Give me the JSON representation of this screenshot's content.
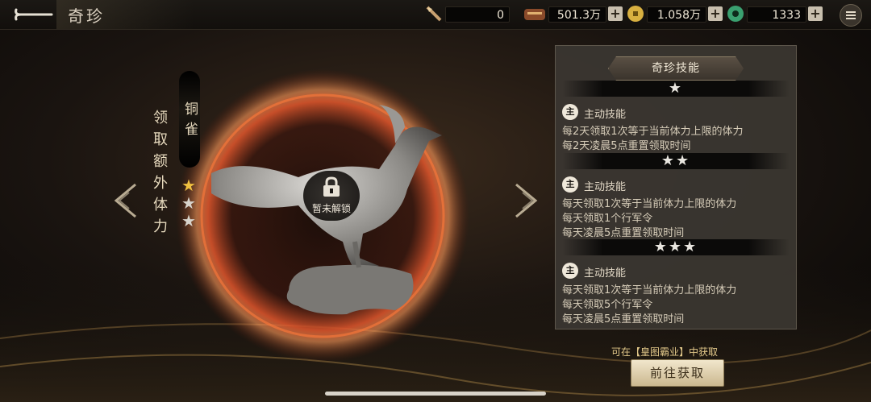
{
  "header": {
    "title": "奇珍",
    "resources": [
      {
        "icon": "arrow-item-icon",
        "value": "0"
      },
      {
        "icon": "bag-icon",
        "value": "501.3万"
      },
      {
        "icon": "gold-coin-icon",
        "value": "1.058万"
      },
      {
        "icon": "jade-icon",
        "value": "1333"
      }
    ],
    "plus_label": "+"
  },
  "treasure": {
    "name": "铜雀",
    "desc": "领取额外体力",
    "stars_filled": 1,
    "stars_total": 3,
    "lock_text": "暂未解锁"
  },
  "skill_panel": {
    "title": "奇珍技能",
    "tiers": [
      {
        "stars": "★",
        "tag": "主",
        "type": "主动技能",
        "lines": [
          "每2天领取1次等于当前体力上限的体力",
          "每2天凌晨5点重置领取时间"
        ]
      },
      {
        "stars": "★★",
        "tag": "主",
        "type": "主动技能",
        "lines": [
          "每天领取1次等于当前体力上限的体力",
          "每天领取1个行军令",
          "每天凌晨5点重置领取时间"
        ]
      },
      {
        "stars": "★★★",
        "tag": "主",
        "type": "主动技能",
        "lines": [
          "每天领取1次等于当前体力上限的体力",
          "每天领取5个行军令",
          "每天凌晨5点重置领取时间"
        ]
      }
    ]
  },
  "source_text": "可在【皇图霸业】中获取",
  "go_button": "前往获取",
  "colors": {
    "accent_gold": "#e2c88a",
    "panel": "#3a3631",
    "ring": "#d8502a"
  }
}
